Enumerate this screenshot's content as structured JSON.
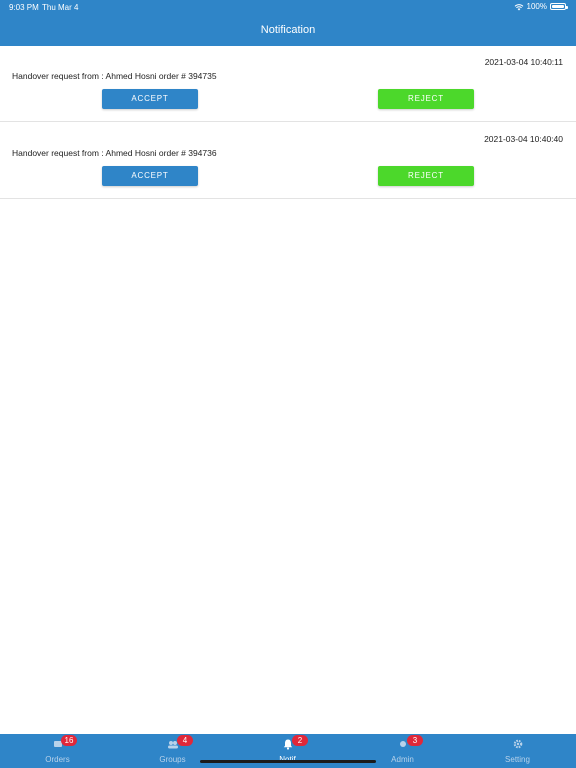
{
  "status_bar": {
    "time": "9:03 PM",
    "date": "Thu Mar 4",
    "battery": "100%"
  },
  "header": {
    "title": "Notification"
  },
  "notifications": [
    {
      "timestamp": "2021-03-04 10:40:11",
      "message": "Handover request from : Ahmed Hosni order # 394735",
      "accept_label": "ACCEPT",
      "reject_label": "REJECT"
    },
    {
      "timestamp": "2021-03-04 10:40:40",
      "message": "Handover request from : Ahmed Hosni order # 394736",
      "accept_label": "ACCEPT",
      "reject_label": "REJECT"
    }
  ],
  "tabbar": {
    "tabs": [
      {
        "label": "Orders",
        "badge": "16",
        "icon": "orders-icon"
      },
      {
        "label": "Groups",
        "badge": "4",
        "icon": "groups-icon"
      },
      {
        "label": "Notif",
        "badge": "2",
        "icon": "bell-icon"
      },
      {
        "label": "Admin",
        "badge": "3",
        "icon": "admin-icon"
      },
      {
        "label": "Setting",
        "badge": "",
        "icon": "gear-icon"
      }
    ]
  },
  "colors": {
    "primary": "#2f85c8",
    "accept": "#2f85c8",
    "reject": "#4cd82b",
    "badge": "#e0283a"
  }
}
